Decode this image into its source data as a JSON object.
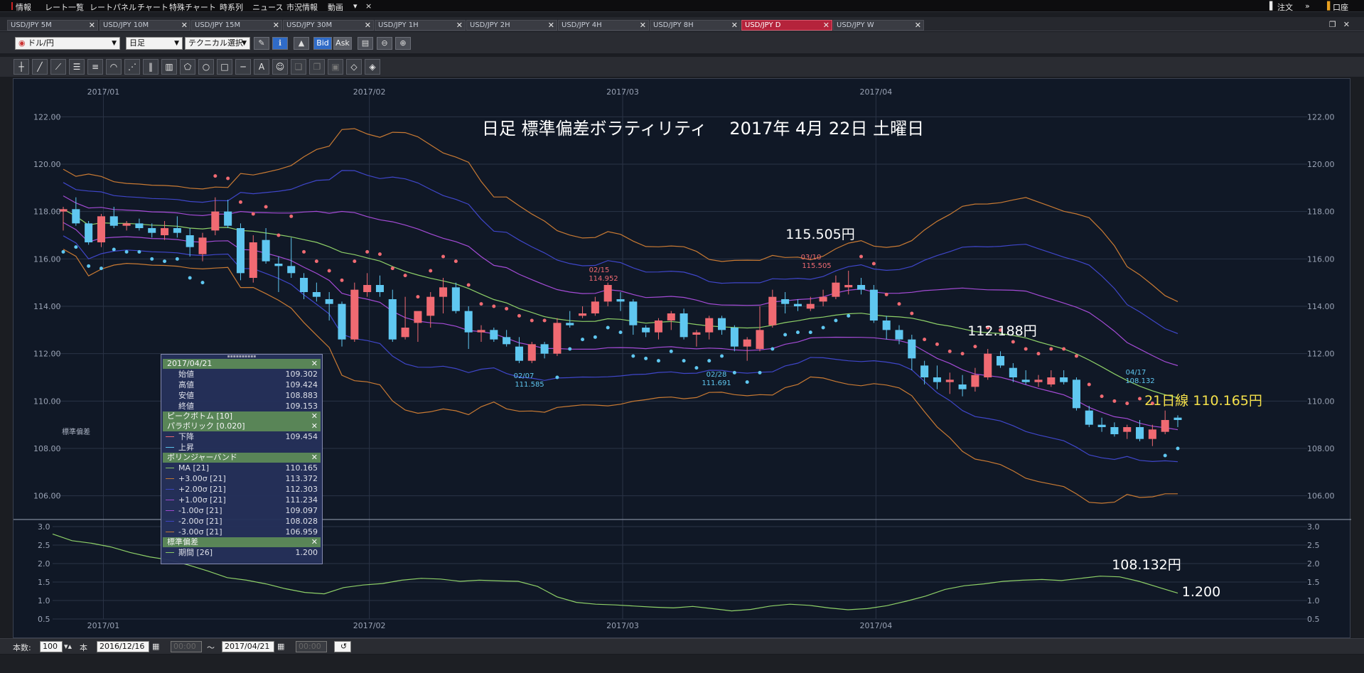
{
  "menubar": {
    "items": [
      "情報",
      "レート一覧",
      "レートパネル",
      "チャート",
      "特殊チャート",
      "時系列",
      "ニュース",
      "市況情報",
      "動画",
      "▾",
      "×"
    ],
    "order_label": "注文",
    "account_label": "口座"
  },
  "tabs": [
    {
      "label": "USD/JPY 5M",
      "active": false
    },
    {
      "label": "USD/JPY 10M",
      "active": false
    },
    {
      "label": "USD/JPY 15M",
      "active": false
    },
    {
      "label": "USD/JPY 30M",
      "active": false
    },
    {
      "label": "USD/JPY 1H",
      "active": false
    },
    {
      "label": "USD/JPY 2H",
      "active": false
    },
    {
      "label": "USD/JPY 4H",
      "active": false
    },
    {
      "label": "USD/JPY 8H",
      "active": false
    },
    {
      "label": "USD/JPY D",
      "active": true
    },
    {
      "label": "USD/JPY W",
      "active": false
    }
  ],
  "toolbar": {
    "pair": "ドル/円",
    "period": "日足",
    "technical": "テクニカル選択",
    "bid": "Bid",
    "ask": "Ask"
  },
  "chart": {
    "title": "日足 標準偏差ボラティリティ　 2017年 4月 22日 土曜日",
    "annotations": {
      "high_label": "115.505円",
      "mid_label": "112.188円",
      "low_label": "108.132円",
      "ma_label": "21日線 110.165円",
      "sd_label": "1.200",
      "peak_0215": "02/15",
      "peak_0215_val": "114.952",
      "peak_0310": "03/10",
      "peak_0310_val": "115.505",
      "bottom_0207": "02/07",
      "bottom_0207_val": "111.585",
      "bottom_0228": "02/28",
      "bottom_0228_val": "111.691",
      "bottom_0417": "04/17",
      "bottom_0417_val": "108.132"
    },
    "sub_label": "標準偏差",
    "colors": {
      "up": "#f06a72",
      "down": "#5fc7f0",
      "ma": "#8ed068",
      "sd1": "#a44bd6",
      "sd2": "#3f46c9",
      "sd3": "#c97a33",
      "psar_down": "#f06a72",
      "psar_up": "#5fc7f0",
      "ma_text": "#f4e04a"
    }
  },
  "chart_data": [
    {
      "type": "candlestick",
      "title": "日足 標準偏差ボラティリティ　 2017年 4月 22日 土曜日",
      "x_ticks": [
        "2017/01",
        "2017/02",
        "2017/03",
        "2017/04"
      ],
      "y_ticks": [
        "122.00",
        "120.00",
        "118.00",
        "116.00",
        "114.00",
        "112.00",
        "110.00",
        "108.00",
        "106.00"
      ],
      "ylim": [
        105.0,
        123.0
      ],
      "candles": [
        [
          118.0,
          118.2,
          117.2,
          118.1
        ],
        [
          118.1,
          118.6,
          117.4,
          117.5
        ],
        [
          117.5,
          117.6,
          116.6,
          116.7
        ],
        [
          116.7,
          117.9,
          116.5,
          117.8
        ],
        [
          117.8,
          118.2,
          117.3,
          117.4
        ],
        [
          117.4,
          117.6,
          117.2,
          117.5
        ],
        [
          117.5,
          117.7,
          117.2,
          117.3
        ],
        [
          117.3,
          117.5,
          116.9,
          117.1
        ],
        [
          117.0,
          117.6,
          116.8,
          117.3
        ],
        [
          117.3,
          117.8,
          116.9,
          117.1
        ],
        [
          117.0,
          117.3,
          116.1,
          116.5
        ],
        [
          116.2,
          117.1,
          115.9,
          116.9
        ],
        [
          117.2,
          118.6,
          117.0,
          118.0
        ],
        [
          118.0,
          118.5,
          117.3,
          117.4
        ],
        [
          117.3,
          117.5,
          115.1,
          115.4
        ],
        [
          115.2,
          117.0,
          115.0,
          116.7
        ],
        [
          116.8,
          117.3,
          115.8,
          115.9
        ],
        [
          115.8,
          116.1,
          114.6,
          115.7
        ],
        [
          115.7,
          116.9,
          115.2,
          115.4
        ],
        [
          115.2,
          115.4,
          114.3,
          114.6
        ],
        [
          114.6,
          115.0,
          114.2,
          114.4
        ],
        [
          114.3,
          114.6,
          113.4,
          114.1
        ],
        [
          114.1,
          114.2,
          112.3,
          112.6
        ],
        [
          112.6,
          115.0,
          112.5,
          114.7
        ],
        [
          114.6,
          115.4,
          114.4,
          114.9
        ],
        [
          114.9,
          115.3,
          114.4,
          114.6
        ],
        [
          114.3,
          114.7,
          112.5,
          112.6
        ],
        [
          112.7,
          114.4,
          112.6,
          113.1
        ],
        [
          113.3,
          113.5,
          112.5,
          113.8
        ],
        [
          113.6,
          114.6,
          113.1,
          114.4
        ],
        [
          114.4,
          115.2,
          113.7,
          114.8
        ],
        [
          114.8,
          115.0,
          113.7,
          113.8
        ],
        [
          113.8,
          114.0,
          112.2,
          112.9
        ],
        [
          112.9,
          113.2,
          112.5,
          113.0
        ],
        [
          113.0,
          113.1,
          112.5,
          112.6
        ],
        [
          112.7,
          113.0,
          112.3,
          112.4
        ],
        [
          112.3,
          112.7,
          111.6,
          111.7
        ],
        [
          111.7,
          112.5,
          111.6,
          112.4
        ],
        [
          112.4,
          112.5,
          111.8,
          112.0
        ],
        [
          112.0,
          113.5,
          111.9,
          113.3
        ],
        [
          113.3,
          113.8,
          113.1,
          113.2
        ],
        [
          113.6,
          114.0,
          113.5,
          113.7
        ],
        [
          113.7,
          114.4,
          113.6,
          114.2
        ],
        [
          114.2,
          115.0,
          114.0,
          114.9
        ],
        [
          114.3,
          114.6,
          113.8,
          114.2
        ],
        [
          114.2,
          114.3,
          112.8,
          113.2
        ],
        [
          113.1,
          113.2,
          112.7,
          112.9
        ],
        [
          112.9,
          113.5,
          112.6,
          113.4
        ],
        [
          113.4,
          113.8,
          113.0,
          113.7
        ],
        [
          113.7,
          113.9,
          112.6,
          112.7
        ],
        [
          112.8,
          113.0,
          112.3,
          112.9
        ],
        [
          112.9,
          113.6,
          112.6,
          113.5
        ],
        [
          113.5,
          113.6,
          112.8,
          113.0
        ],
        [
          113.1,
          113.2,
          112.1,
          112.3
        ],
        [
          112.3,
          112.7,
          111.7,
          112.6
        ],
        [
          112.2,
          114.0,
          112.1,
          113.0
        ],
        [
          113.2,
          114.7,
          113.1,
          114.4
        ],
        [
          114.3,
          114.6,
          113.7,
          114.1
        ],
        [
          114.1,
          114.3,
          113.8,
          114.0
        ],
        [
          113.9,
          114.4,
          113.8,
          114.1
        ],
        [
          114.2,
          114.7,
          114.0,
          114.4
        ],
        [
          114.4,
          115.3,
          114.3,
          115.0
        ],
        [
          114.8,
          115.5,
          114.5,
          114.9
        ],
        [
          114.9,
          115.2,
          114.5,
          114.7
        ],
        [
          114.7,
          114.9,
          113.3,
          113.4
        ],
        [
          113.4,
          113.6,
          112.6,
          113.0
        ],
        [
          113.0,
          113.2,
          112.4,
          112.6
        ],
        [
          112.6,
          112.8,
          111.3,
          111.8
        ],
        [
          111.5,
          111.7,
          110.7,
          111.0
        ],
        [
          111.0,
          111.5,
          110.5,
          110.8
        ],
        [
          110.8,
          111.2,
          110.3,
          110.9
        ],
        [
          110.7,
          111.1,
          110.2,
          110.5
        ],
        [
          110.6,
          111.4,
          110.4,
          111.1
        ],
        [
          111.0,
          112.2,
          110.9,
          112.0
        ],
        [
          111.9,
          112.1,
          111.4,
          111.5
        ],
        [
          111.4,
          111.6,
          110.8,
          111.0
        ],
        [
          110.9,
          111.3,
          110.7,
          110.8
        ],
        [
          110.8,
          111.1,
          110.6,
          110.9
        ],
        [
          110.7,
          111.3,
          110.6,
          111.0
        ],
        [
          111.0,
          111.3,
          110.7,
          110.8
        ],
        [
          110.9,
          111.0,
          109.6,
          109.7
        ],
        [
          109.6,
          109.8,
          108.9,
          109.0
        ],
        [
          109.0,
          109.3,
          108.7,
          108.9
        ],
        [
          108.9,
          109.1,
          108.5,
          108.6
        ],
        [
          108.7,
          109.0,
          108.4,
          108.9
        ],
        [
          108.9,
          109.2,
          108.3,
          108.4
        ],
        [
          108.4,
          109.0,
          108.1,
          108.8
        ],
        [
          108.7,
          109.6,
          108.6,
          109.2
        ],
        [
          109.3,
          109.4,
          108.9,
          109.2
        ]
      ],
      "bollinger_last": {
        "ma": 110.165,
        "p3": 113.372,
        "p2": 112.303,
        "p1": 111.234,
        "m1": 109.097,
        "m2": 108.028,
        "m3": 106.959
      }
    },
    {
      "type": "line",
      "title": "標準偏差",
      "y_ticks": [
        "3.0",
        "2.5",
        "2.0",
        "1.5",
        "1.0",
        "0.5"
      ],
      "ylim": [
        0.5,
        3.0
      ],
      "series": [
        {
          "name": "期間 [26]",
          "values": [
            2.8,
            2.62,
            2.55,
            2.45,
            2.3,
            2.18,
            2.1,
            1.96,
            1.8,
            1.62,
            1.55,
            1.45,
            1.32,
            1.22,
            1.18,
            1.35,
            1.42,
            1.46,
            1.55,
            1.6,
            1.58,
            1.52,
            1.55,
            1.53,
            1.52,
            1.38,
            1.1,
            0.95,
            0.9,
            0.88,
            0.85,
            0.82,
            0.8,
            0.84,
            0.78,
            0.72,
            0.76,
            0.85,
            0.9,
            0.87,
            0.8,
            0.75,
            0.78,
            0.86,
            0.98,
            1.12,
            1.3,
            1.4,
            1.45,
            1.52,
            1.55,
            1.57,
            1.54,
            1.6,
            1.66,
            1.64,
            1.52,
            1.36,
            1.2
          ]
        }
      ]
    }
  ],
  "datawindow": {
    "date": "2017/04/21",
    "ohlc": [
      {
        "label": "始値",
        "value": "109.302"
      },
      {
        "label": "高値",
        "value": "109.424"
      },
      {
        "label": "安値",
        "value": "108.883"
      },
      {
        "label": "終値",
        "value": "109.153"
      }
    ],
    "peak_bottom": "ピークボトム [10]",
    "parabolic": "パラボリック [0.020]",
    "parabolic_rows": [
      {
        "label": "下降",
        "value": "109.454",
        "color": "#f06a72"
      },
      {
        "label": "上昇",
        "value": "",
        "color": "#5fc7f0"
      }
    ],
    "bollinger": "ボリンジャーバンド",
    "bollinger_rows": [
      {
        "label": "MA [21]",
        "value": "110.165",
        "color": "#8ed068"
      },
      {
        "label": "+3.00σ [21]",
        "value": "113.372",
        "color": "#c97a33"
      },
      {
        "label": "+2.00σ [21]",
        "value": "112.303",
        "color": "#3f46c9"
      },
      {
        "label": "+1.00σ [21]",
        "value": "111.234",
        "color": "#a44bd6"
      },
      {
        "label": "-1.00σ [21]",
        "value": "109.097",
        "color": "#a44bd6"
      },
      {
        "label": "-2.00σ [21]",
        "value": "108.028",
        "color": "#3f46c9"
      },
      {
        "label": "-3.00σ [21]",
        "value": "106.959",
        "color": "#c97a33"
      }
    ],
    "stddev": "標準偏差",
    "stddev_rows": [
      {
        "label": "期間 [26]",
        "value": "1.200",
        "color": "#8ed068"
      }
    ]
  },
  "bottombar": {
    "count_label": "本数:",
    "count_value": "100",
    "unit": "本",
    "from_date": "2016/12/16",
    "from_time": "00:00",
    "tilde": "〜",
    "to_date": "2017/04/21",
    "to_time": "00:00"
  }
}
